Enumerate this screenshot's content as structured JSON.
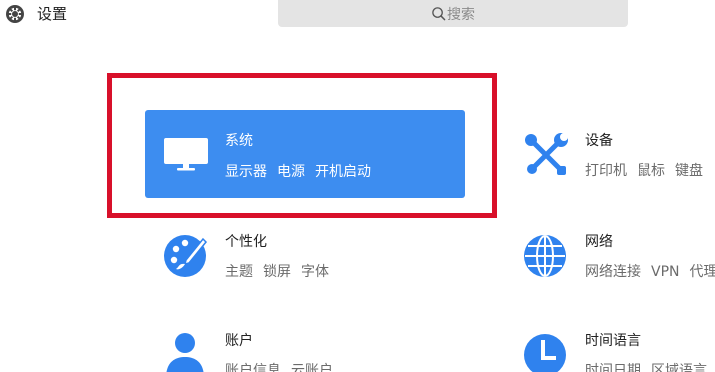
{
  "header": {
    "title": "设置",
    "search_placeholder": "搜索"
  },
  "colors": {
    "accent": "#3d8df0",
    "icon": "#2f82ee",
    "highlight": "#d8102a"
  },
  "categories": [
    {
      "name": "系统",
      "icon": "monitor-icon",
      "selected": true,
      "items": [
        "显示器",
        "电源",
        "开机启动"
      ]
    },
    {
      "name": "设备",
      "icon": "tools-icon",
      "items": [
        "打印机",
        "鼠标",
        "键盘"
      ]
    },
    {
      "name": "个性化",
      "icon": "palette-icon",
      "items": [
        "主题",
        "锁屏",
        "字体"
      ]
    },
    {
      "name": "网络",
      "icon": "globe-icon",
      "items": [
        "网络连接",
        "VPN",
        "代理"
      ]
    },
    {
      "name": "账户",
      "icon": "user-icon",
      "items": [
        "账户信息",
        "云账户"
      ]
    },
    {
      "name": "时间语言",
      "icon": "clock-icon",
      "items": [
        "时间日期",
        "区域语言"
      ]
    }
  ]
}
